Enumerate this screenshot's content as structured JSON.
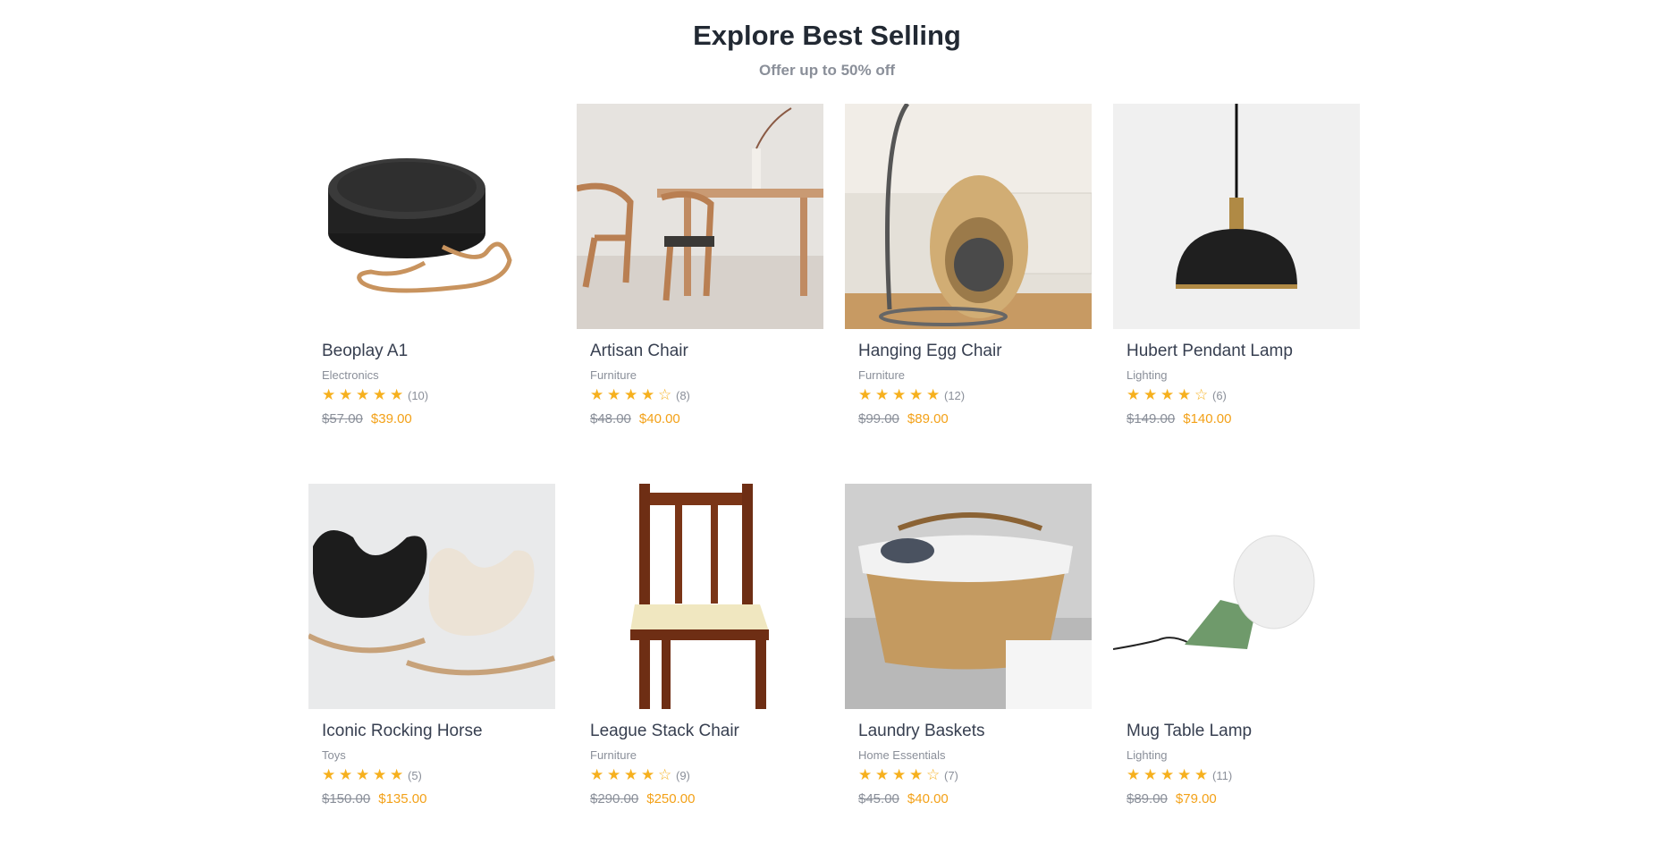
{
  "section": {
    "title": "Explore Best Selling",
    "subtitle": "Offer up to 50% off"
  },
  "colors": {
    "accent": "#f3a118",
    "star": "#f6b01e",
    "muted": "#8a8f99"
  },
  "products": [
    {
      "name": "Beoplay A1",
      "category": "Electronics",
      "rating": 5,
      "count": "(10)",
      "old_price": "$57.00",
      "price": "$39.00",
      "image": "speaker"
    },
    {
      "name": "Artisan Chair",
      "category": "Furniture",
      "rating": 4.5,
      "count": "(8)",
      "old_price": "$48.00",
      "price": "$40.00",
      "image": "dining-chairs"
    },
    {
      "name": "Hanging Egg Chair",
      "category": "Furniture",
      "rating": 5,
      "count": "(12)",
      "old_price": "$99.00",
      "price": "$89.00",
      "image": "egg-chair"
    },
    {
      "name": "Hubert Pendant Lamp",
      "category": "Lighting",
      "rating": 4.5,
      "count": "(6)",
      "old_price": "$149.00",
      "price": "$140.00",
      "image": "pendant-lamp"
    },
    {
      "name": "Iconic Rocking Horse",
      "category": "Toys",
      "rating": 5,
      "count": "(5)",
      "old_price": "$150.00",
      "price": "$135.00",
      "image": "rocking-horse"
    },
    {
      "name": "League Stack Chair",
      "category": "Furniture",
      "rating": 4.5,
      "count": "(9)",
      "old_price": "$290.00",
      "price": "$250.00",
      "image": "wood-chair"
    },
    {
      "name": "Laundry Baskets",
      "category": "Home Essentials",
      "rating": 4.5,
      "count": "(7)",
      "old_price": "$45.00",
      "price": "$40.00",
      "image": "laundry-basket"
    },
    {
      "name": "Mug Table Lamp",
      "category": "Lighting",
      "rating": 5,
      "count": "(11)",
      "old_price": "$89.00",
      "price": "$79.00",
      "image": "table-lamp"
    }
  ]
}
